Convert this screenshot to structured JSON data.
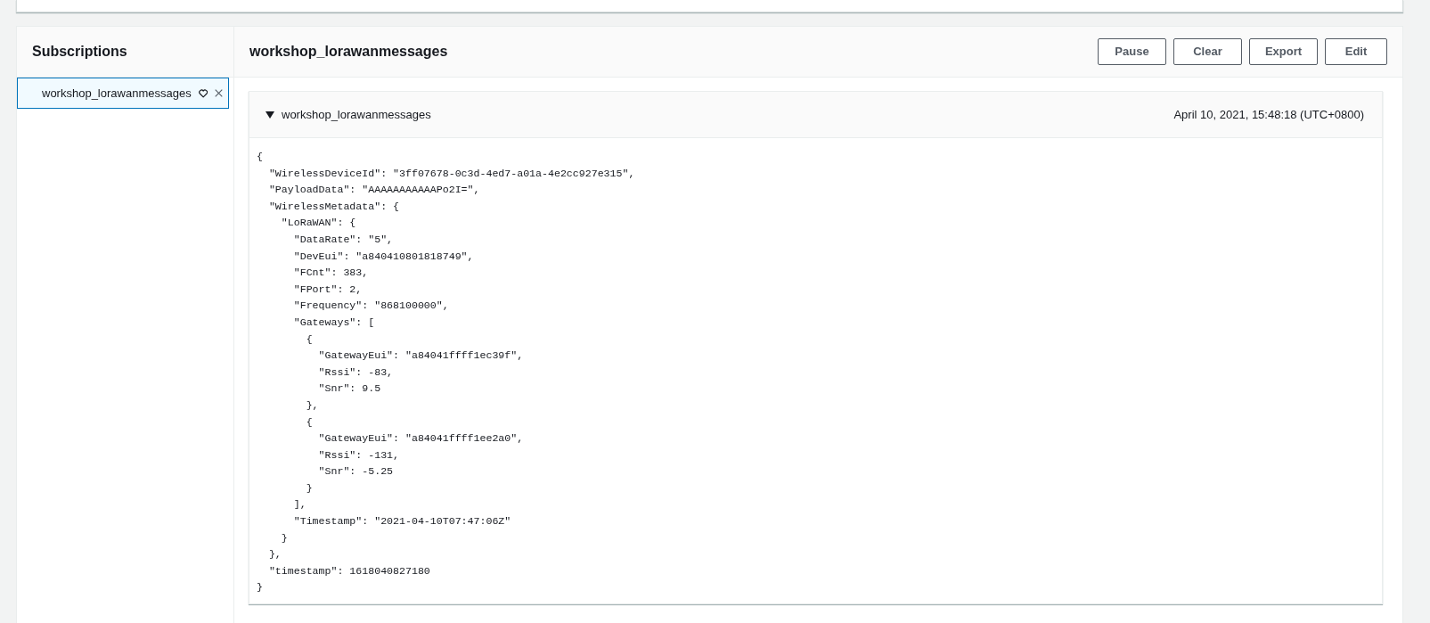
{
  "sidebar": {
    "title": "Subscriptions",
    "items": [
      {
        "label": "workshop_lorawanmessages",
        "selected": true
      }
    ]
  },
  "panel": {
    "title": "workshop_lorawanmessages",
    "buttons": [
      "Pause",
      "Clear",
      "Export",
      "Edit"
    ]
  },
  "message": {
    "topic": "workshop_lorawanmessages",
    "expanded": true,
    "time": "April 10, 2021, 15:48:18 (UTC+0800)",
    "body_lines": [
      "{",
      "  \"WirelessDeviceId\": \"3ff07678-0c3d-4ed7-a01a-4e2cc927e315\",",
      "  \"PayloadData\": \"AAAAAAAAAAAPo2I=\",",
      "  \"WirelessMetadata\": {",
      "    \"LoRaWAN\": {",
      "      \"DataRate\": \"5\",",
      "      \"DevEui\": \"a840410801818749\",",
      "      \"FCnt\": 383,",
      "      \"FPort\": 2,",
      "      \"Frequency\": \"868100000\",",
      "      \"Gateways\": [",
      "        {",
      "          \"GatewayEui\": \"a84041ffff1ec39f\",",
      "          \"Rssi\": -83,",
      "          \"Snr\": 9.5",
      "        },",
      "        {",
      "          \"GatewayEui\": \"a84041ffff1ee2a0\",",
      "          \"Rssi\": -131,",
      "          \"Snr\": -5.25",
      "        }",
      "      ],",
      "      \"Timestamp\": \"2021-04-10T07:47:06Z\"",
      "    }",
      "  },",
      "  \"timestamp\": 1618040827180",
      "}"
    ]
  }
}
